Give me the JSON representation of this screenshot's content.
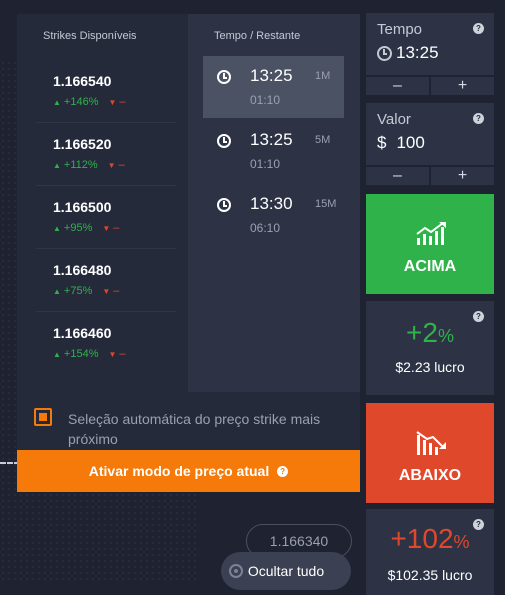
{
  "strikes": {
    "header": "Strikes Disponíveis",
    "items": [
      {
        "value": "1.166540",
        "up": "+146%",
        "down": "–"
      },
      {
        "value": "1.166520",
        "up": "+112%",
        "down": "–"
      },
      {
        "value": "1.166500",
        "up": "+95%",
        "down": "–"
      },
      {
        "value": "1.166480",
        "up": "+75%",
        "down": "–"
      },
      {
        "value": "1.166460",
        "up": "+154%",
        "down": "–"
      }
    ]
  },
  "times": {
    "header": "Tempo / Restante",
    "items": [
      {
        "time": "13:25",
        "remaining": "01:10",
        "tag": "1M",
        "selected": true
      },
      {
        "time": "13:25",
        "remaining": "01:10",
        "tag": "5M",
        "selected": false
      },
      {
        "time": "13:30",
        "remaining": "06:10",
        "tag": "15M",
        "selected": false
      }
    ]
  },
  "auto_select": {
    "label": "Seleção automática do preço strike mais próximo",
    "checked": true
  },
  "current_price_button": "Ativar modo de preço atual",
  "price_tag": "1.166340",
  "hide_all": "Ocultar tudo",
  "tempo": {
    "label": "Tempo",
    "value": "13:25",
    "minus": "–",
    "plus": "+"
  },
  "valor": {
    "label": "Valor",
    "currency": "$",
    "value": "100",
    "minus": "–",
    "plus": "+"
  },
  "call": {
    "label": "ACIMA",
    "color": "#2fb24a"
  },
  "call_profit": {
    "percent": "+2",
    "percent_sign": "%",
    "amount": "$2.23 lucro"
  },
  "put": {
    "label": "ABAIXO",
    "color": "#e0482c"
  },
  "put_profit": {
    "percent": "+102",
    "percent_sign": "%",
    "amount": "$102.35 lucro"
  },
  "help_glyph": "?",
  "colors": {
    "accent": "#f57a0a",
    "up": "#2fb24a",
    "down": "#e0482c"
  }
}
